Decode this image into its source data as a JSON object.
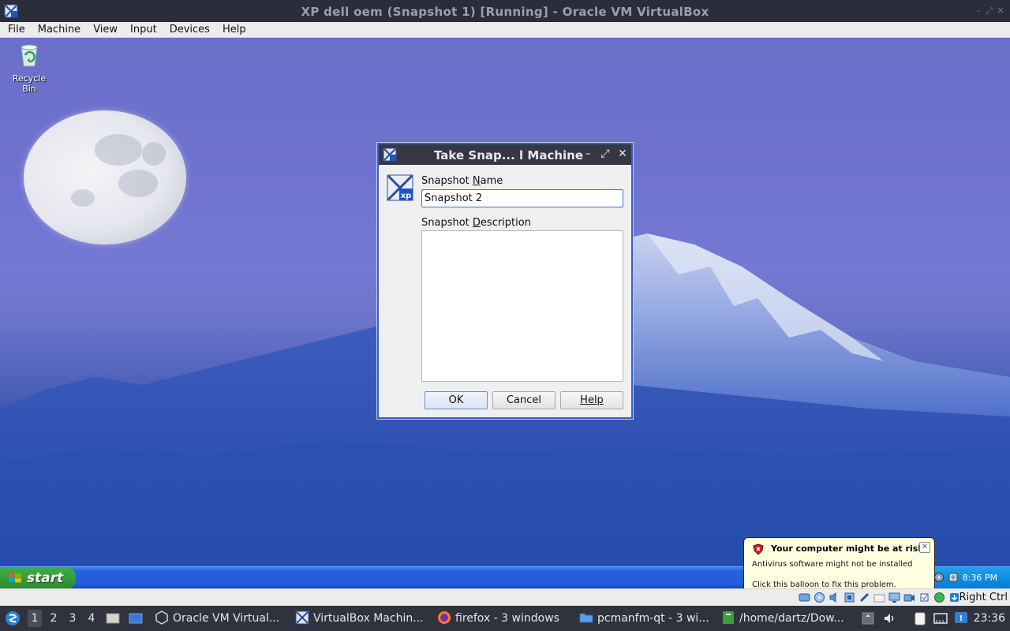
{
  "host_window": {
    "title": "XP dell oem (Snapshot 1) [Running] - Oracle VM VirtualBox",
    "controls": [
      "minimize",
      "maximize",
      "close"
    ]
  },
  "host_menubar": [
    "File",
    "Machine",
    "View",
    "Input",
    "Devices",
    "Help"
  ],
  "desktop": {
    "icons": [
      {
        "label": "Recycle Bin",
        "icon": "recycle-bin-icon"
      }
    ]
  },
  "dialog": {
    "title": "Take Snap... l Machine",
    "name_label_pre": "Snapshot ",
    "name_label_u": "N",
    "name_label_post": "ame",
    "name_value": "Snapshot 2",
    "desc_label_pre": "Snapshot ",
    "desc_label_u": "D",
    "desc_label_post": "escription",
    "desc_value": "",
    "ok_label": "OK",
    "cancel_label": "Cancel",
    "help_label": "Help"
  },
  "balloon": {
    "title": "Your computer might be at risk",
    "line1": "Antivirus software might not be installed",
    "line2": "Click this balloon to fix this problem."
  },
  "xp_taskbar": {
    "start_label": "start",
    "clock": "8:36 PM"
  },
  "vb_status": {
    "host_key": "Right Ctrl"
  },
  "host_panel": {
    "workspaces": [
      "1",
      "2",
      "3",
      "4"
    ],
    "active_workspace": "1",
    "tasks": [
      {
        "label": "Oracle VM Virtual...",
        "icon": "virtualbox-icon"
      },
      {
        "label": "VirtualBox Machin...",
        "icon": "virtualbox-xp-icon"
      },
      {
        "label": "firefox - 3 windows",
        "icon": "firefox-icon"
      },
      {
        "label": "pcmanfm-qt - 3 wi...",
        "icon": "folder-icon"
      },
      {
        "label": "/home/dartz/Dow...",
        "icon": "terminal-icon"
      }
    ],
    "clock": "23:36"
  },
  "colors": {
    "xp_taskbar_blue": "#245edb",
    "start_green": "#37a23b",
    "balloon_bg": "#ffffe1",
    "dialog_border": "#3a5ec6"
  }
}
